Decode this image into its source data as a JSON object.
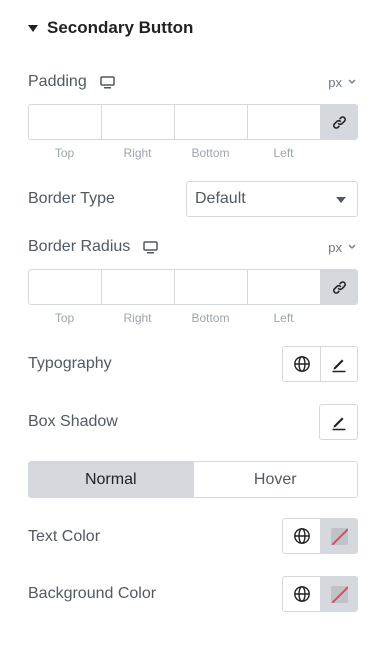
{
  "section": {
    "title": "Secondary Button",
    "expanded": true
  },
  "padding": {
    "label": "Padding",
    "device_icon": "desktop-icon",
    "unit": "px",
    "values": {
      "top": "",
      "right": "",
      "bottom": "",
      "left": ""
    },
    "labels": [
      "Top",
      "Right",
      "Bottom",
      "Left"
    ],
    "link_icon": "link-icon"
  },
  "border_type": {
    "label": "Border Type",
    "selected": "Default"
  },
  "border_radius": {
    "label": "Border Radius",
    "device_icon": "desktop-icon",
    "unit": "px",
    "values": {
      "top": "",
      "right": "",
      "bottom": "",
      "left": ""
    },
    "labels": [
      "Top",
      "Right",
      "Bottom",
      "Left"
    ],
    "link_icon": "link-icon"
  },
  "typography": {
    "label": "Typography",
    "icons": [
      "globe-icon",
      "pencil-icon"
    ]
  },
  "box_shadow": {
    "label": "Box Shadow",
    "icons": [
      "pencil-icon"
    ]
  },
  "state_tabs": {
    "normal": "Normal",
    "hover": "Hover",
    "active": "Normal"
  },
  "text_color": {
    "label": "Text Color",
    "icons": [
      "globe-icon",
      "color-swatch-icon"
    ]
  },
  "background_color": {
    "label": "Background Color",
    "icons": [
      "globe-icon",
      "color-swatch-icon"
    ]
  },
  "colors": {
    "border": "#d5d8dc",
    "label": "#515962",
    "heading": "#1f2124",
    "muted": "#9da5ae",
    "swatch_slash": "#e2475d"
  }
}
